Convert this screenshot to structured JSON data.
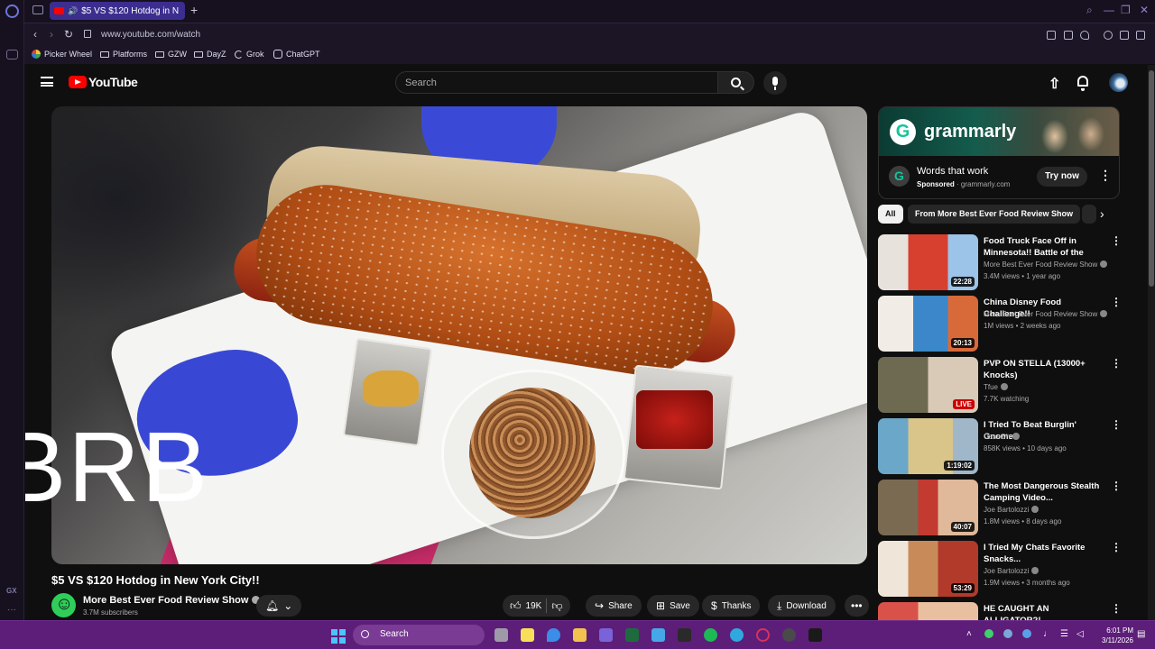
{
  "browser": {
    "tab_title": "$5 VS $120 Hotdog in N",
    "new_tab": "+",
    "url": "www.youtube.com/watch",
    "bookmarks": [
      "Picker Wheel",
      "Platforms",
      "GZW",
      "DayZ",
      "Grok",
      "ChatGPT"
    ],
    "sidebar_gx": "GX",
    "sidebar_more": "···"
  },
  "youtube": {
    "logo_text": "YouTube",
    "search_placeholder": "Search"
  },
  "video": {
    "overlay_text": "BRB",
    "title": "$5 VS $120 Hotdog in New York City!!",
    "channel": "More Best Ever Food Review Show",
    "subscribers": "3.7M subscribers",
    "likes": "19K",
    "share": "Share",
    "save": "Save",
    "thanks": "Thanks",
    "download": "Download"
  },
  "ad": {
    "brand": "grammarly",
    "brand_letter": "G",
    "headline": "Words that work",
    "sponsored": "Sponsored",
    "domain": "· grammarly.com",
    "cta": "Try now"
  },
  "chips": {
    "all": "All",
    "channel": "From More Best Ever Food Review Show"
  },
  "recommendations": [
    {
      "title": "Food Truck Face Off in Minnesota!! Battle of the Bites!!",
      "channel": "More Best Ever Food Review Show",
      "meta": "3.4M views • 1 year ago",
      "duration": "22:28"
    },
    {
      "title": "China Disney Food Challenge!!",
      "channel": "More Best Ever Food Review Show",
      "meta": "1M views • 2 weeks ago",
      "duration": "20:13"
    },
    {
      "title": "PVP ON STELLA (13000+ Knocks)",
      "channel": "Tfue",
      "meta": "7.7K watching",
      "duration": "LIVE"
    },
    {
      "title": "I Tried To Beat Burglin' Gnomes",
      "channel": "CaseOh",
      "meta": "858K views • 10 days ago",
      "duration": "1:19:02"
    },
    {
      "title": "The Most Dangerous Stealth Camping Video...",
      "channel": "Joe Bartolozzi",
      "meta": "1.8M views • 8 days ago",
      "duration": "40:07"
    },
    {
      "title": "I Tried My Chats Favorite Snacks...",
      "channel": "Joe Bartolozzi",
      "meta": "1.9M views • 3 months ago",
      "duration": "53:29"
    },
    {
      "title": "HE CAUGHT AN ALLIGATOR?!",
      "channel": "",
      "meta": "",
      "duration": ""
    }
  ],
  "taskbar": {
    "search": "Search",
    "time": "6:01 PM",
    "date": "3/11/2026"
  }
}
